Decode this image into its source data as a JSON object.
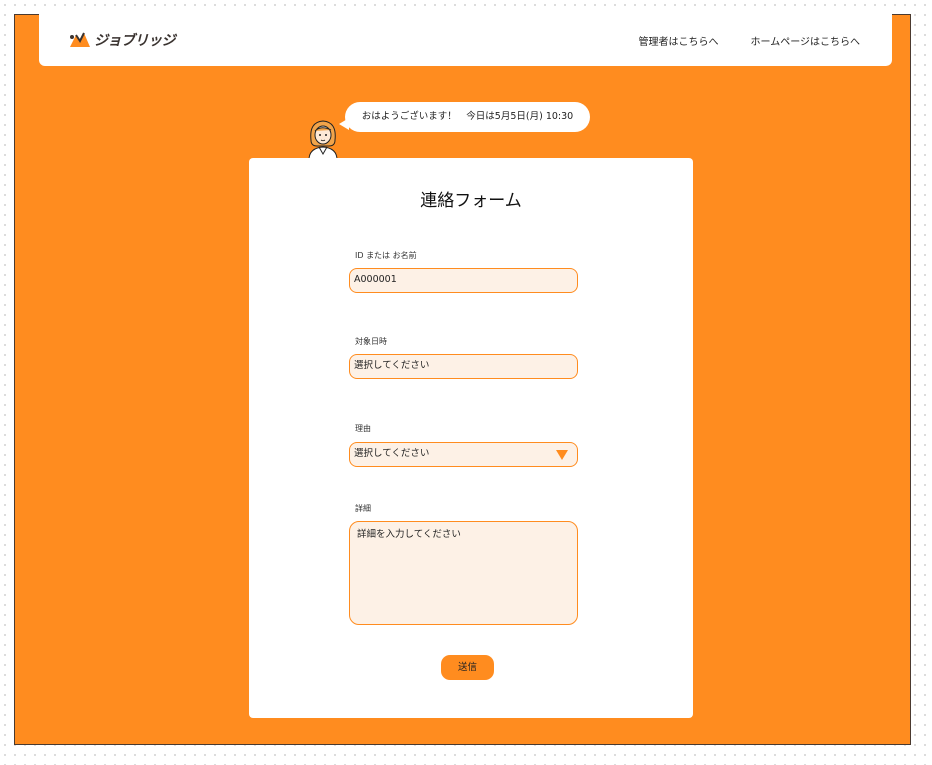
{
  "header": {
    "logo_text": "ジョブリッジ",
    "nav": [
      "管理者はこちらへ",
      "ホームページはこちらへ"
    ]
  },
  "greeting": {
    "text": "おはようございます！　今日は5月5日(月) 10:30"
  },
  "form": {
    "title": "連絡フォーム",
    "id_label": "ID または お名前",
    "id_value": "A000001",
    "date_label": "対象日時",
    "date_value": "選択してください",
    "reason_label": "理由",
    "reason_value": "選択してください",
    "detail_label": "詳細",
    "detail_placeholder": "詳細を入力してください",
    "submit_label": "送信"
  },
  "colors": {
    "accent": "#ff8c1f",
    "field_bg": "#fdf1e6"
  },
  "icons": [
    "logo-icon",
    "user-avatar-icon",
    "chevron-down-icon"
  ]
}
